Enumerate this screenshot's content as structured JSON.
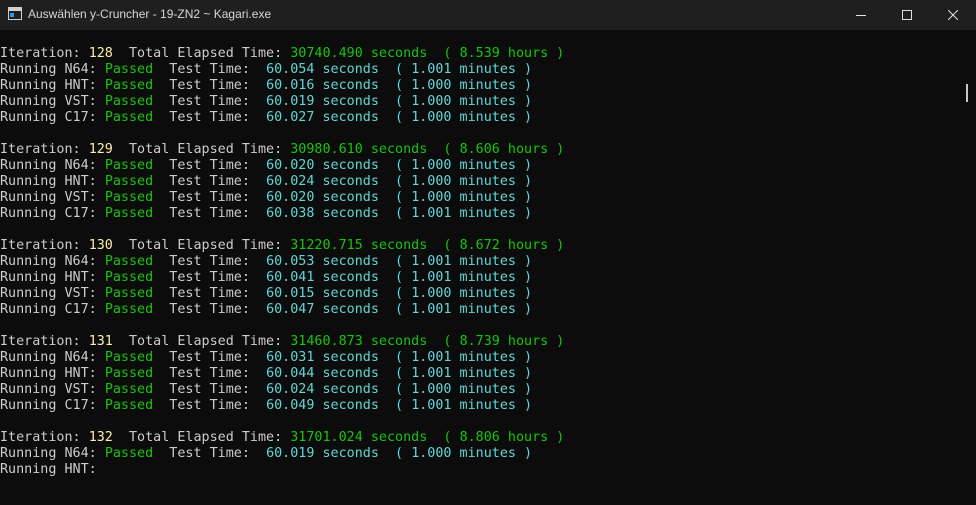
{
  "window": {
    "title": "Auswählen y-Cruncher - 19-ZN2 ~ Kagari.exe",
    "icon": "console-window-icon",
    "controls": [
      "minimize-icon",
      "maximize-icon",
      "close-icon"
    ]
  },
  "labels": {
    "iteration": "Iteration: ",
    "total_elapsed": "  Total Elapsed Time: ",
    "running": "Running ",
    "passed": "Passed",
    "test_time": "  Test Time:  ",
    "seconds": " seconds",
    "open_paren": "  ( ",
    "hours": " hours )",
    "minutes": " minutes )"
  },
  "iterations": [
    {
      "number": "128",
      "elapsed_seconds": "30740.490",
      "elapsed_hours": "8.539",
      "tests": [
        {
          "name": "N64:",
          "seconds": "60.054",
          "minutes": "1.001"
        },
        {
          "name": "HNT:",
          "seconds": "60.016",
          "minutes": "1.000"
        },
        {
          "name": "VST:",
          "seconds": "60.019",
          "minutes": "1.000"
        },
        {
          "name": "C17:",
          "seconds": "60.027",
          "minutes": "1.000"
        }
      ]
    },
    {
      "number": "129",
      "elapsed_seconds": "30980.610",
      "elapsed_hours": "8.606",
      "tests": [
        {
          "name": "N64:",
          "seconds": "60.020",
          "minutes": "1.000"
        },
        {
          "name": "HNT:",
          "seconds": "60.024",
          "minutes": "1.000"
        },
        {
          "name": "VST:",
          "seconds": "60.020",
          "minutes": "1.000"
        },
        {
          "name": "C17:",
          "seconds": "60.038",
          "minutes": "1.001"
        }
      ]
    },
    {
      "number": "130",
      "elapsed_seconds": "31220.715",
      "elapsed_hours": "8.672",
      "tests": [
        {
          "name": "N64:",
          "seconds": "60.053",
          "minutes": "1.001"
        },
        {
          "name": "HNT:",
          "seconds": "60.041",
          "minutes": "1.001"
        },
        {
          "name": "VST:",
          "seconds": "60.015",
          "minutes": "1.000"
        },
        {
          "name": "C17:",
          "seconds": "60.047",
          "minutes": "1.001"
        }
      ]
    },
    {
      "number": "131",
      "elapsed_seconds": "31460.873",
      "elapsed_hours": "8.739",
      "tests": [
        {
          "name": "N64:",
          "seconds": "60.031",
          "minutes": "1.001"
        },
        {
          "name": "HNT:",
          "seconds": "60.044",
          "minutes": "1.001"
        },
        {
          "name": "VST:",
          "seconds": "60.024",
          "minutes": "1.000"
        },
        {
          "name": "C17:",
          "seconds": "60.049",
          "minutes": "1.001"
        }
      ]
    },
    {
      "number": "132",
      "elapsed_seconds": "31701.024",
      "elapsed_hours": "8.806",
      "tests": [
        {
          "name": "N64:",
          "seconds": "60.019",
          "minutes": "1.000"
        },
        {
          "name": "HNT:",
          "pending": true
        }
      ]
    }
  ],
  "colors": {
    "background": "#0c0c0c",
    "titlebar": "#1f1f1f",
    "text": "#cccccc",
    "iteration_number": "#f9f1a5",
    "passed_and_total": "#16c60c",
    "test_time": "#61d6d6"
  }
}
